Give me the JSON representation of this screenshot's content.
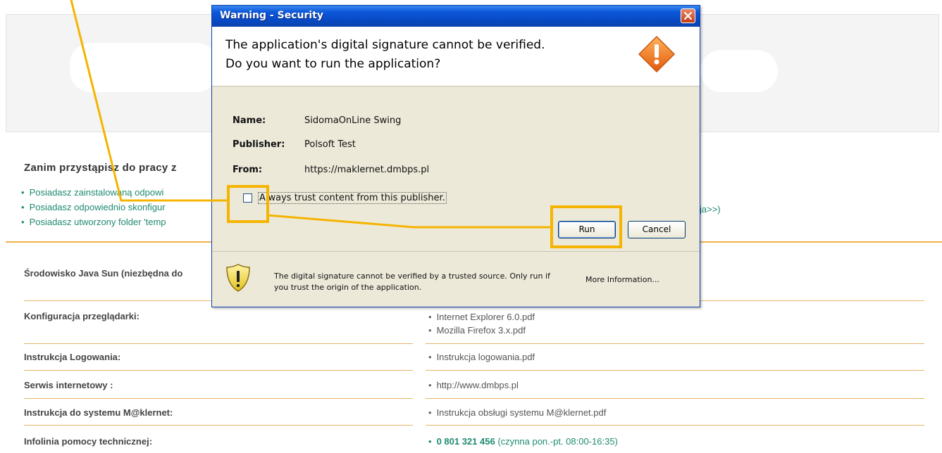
{
  "page": {
    "intro_title": "Zanim przystąpisz do pracy z",
    "bullets": [
      "Posiadasz zainstalowaną odpowi",
      "Posiadasz odpowiednio skonfigur",
      "Posiadasz utworzony folder 'temp"
    ],
    "bullet_overflow_tail": "ja>>)",
    "rows": [
      {
        "label": "Środowisko Java Sun (niezbędna do",
        "items": []
      },
      {
        "label": "Konfiguracja przeglądarki:",
        "items": [
          "Internet Explorer 6.0.pdf",
          "Mozilla Firefox 3.x.pdf"
        ]
      },
      {
        "label": "Instrukcja Logowania:",
        "items": [
          "Instrukcja logowania.pdf"
        ]
      },
      {
        "label": "Serwis internetowy :",
        "items": [
          "http://www.dmbps.pl"
        ]
      },
      {
        "label": "Instrukcja do systemu M@klernet:",
        "items": [
          "Instrukcja obsługi systemu M@klernet.pdf"
        ]
      },
      {
        "label": "Infolinia pomocy technicznej:",
        "phone": "0 801 321 456",
        "phone_hours": "(czynna pon.-pt. 08:00-16:35)"
      }
    ]
  },
  "dialog": {
    "title": "Warning - Security",
    "header_line1": "The application's digital signature cannot be verified.",
    "header_line2": "Do you want to run the application?",
    "fields": [
      {
        "label": "Name:",
        "value": "SidomaOnLine Swing"
      },
      {
        "label": "Publisher:",
        "value": "Polsoft Test"
      },
      {
        "label": "From:",
        "value": "https://maklernet.dmbps.pl"
      }
    ],
    "checkbox_label": "Always trust content from this publisher.",
    "checkbox_checked": false,
    "run_label": "Run",
    "cancel_label": "Cancel",
    "footer_text": "The digital signature cannot be verified by a trusted source.  Only run if you trust the origin of the application.",
    "more_info_label": "More Information..."
  },
  "colors": {
    "annotation": "#f5b400",
    "link_green": "#1f8a70",
    "divider_orange": "#e8b467"
  },
  "icons": [
    "close-icon",
    "warning-diamond-icon",
    "shield-warning-icon"
  ]
}
